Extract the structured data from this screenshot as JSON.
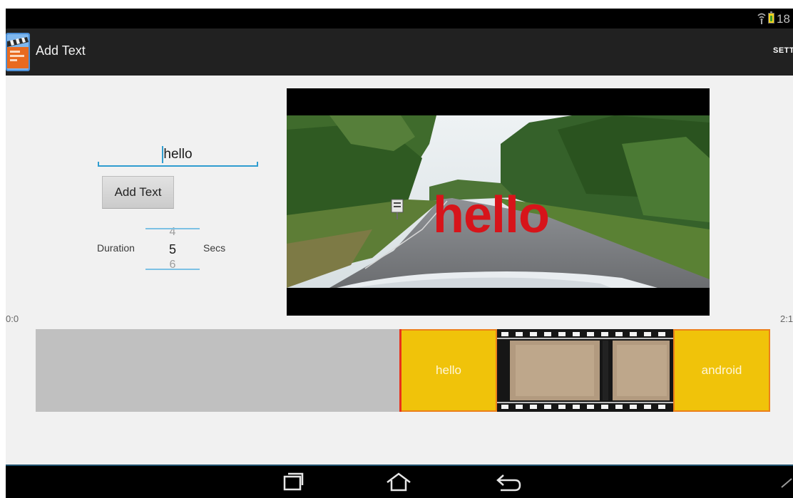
{
  "status_bar": {
    "time": "18"
  },
  "action_bar": {
    "title": "Add Text",
    "settings_label": "SETT",
    "app_icon": "clapperboard-icon"
  },
  "editor": {
    "text_value": "hello",
    "add_button_label": "Add Text",
    "duration_label": "Duration",
    "secs_label": "Secs",
    "picker": {
      "prev": "4",
      "current": "5",
      "next": "6"
    }
  },
  "preview": {
    "overlay_text": "hello",
    "overlay_color": "#d7141a"
  },
  "timeline": {
    "start_time": "0:0",
    "end_time": "2:1",
    "clips": [
      {
        "type": "text",
        "label": "hello"
      },
      {
        "type": "video"
      },
      {
        "type": "text",
        "label": "android"
      }
    ],
    "clip_color": "#f0c30a",
    "clip_border_color": "#ec7f1a"
  },
  "nav_bar": {
    "icons": [
      "recent-apps-icon",
      "home-icon",
      "back-icon"
    ]
  }
}
